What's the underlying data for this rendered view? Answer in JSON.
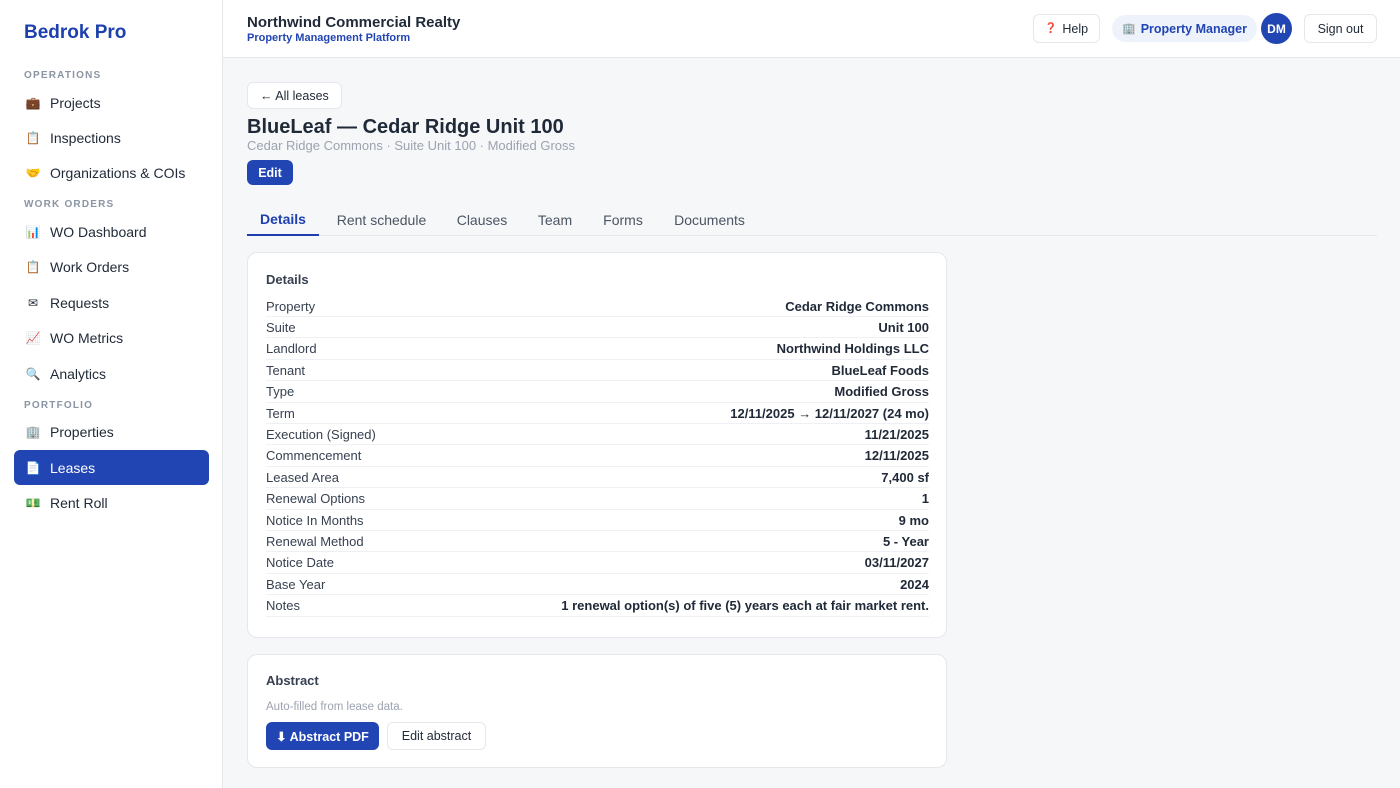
{
  "sidebar": {
    "brand": "Bedrok Pro",
    "sections": [
      {
        "title": "OPERATIONS"
      },
      {
        "title": "WORK ORDERS"
      },
      {
        "title": "PORTFOLIO"
      }
    ],
    "items": [
      {
        "label": "Projects",
        "icon": "briefcase-icon",
        "glyph": "💼"
      },
      {
        "label": "Inspections",
        "icon": "clipboard-icon",
        "glyph": "📋"
      },
      {
        "label": "Organizations & COIs",
        "icon": "handshake-icon",
        "glyph": "🤝"
      },
      {
        "label": "WO Dashboard",
        "icon": "bar-chart-icon",
        "glyph": "📊"
      },
      {
        "label": "Work Orders",
        "icon": "clipboard-icon",
        "glyph": "📋"
      },
      {
        "label": "Requests",
        "icon": "envelope-icon",
        "glyph": "✉"
      },
      {
        "label": "WO Metrics",
        "icon": "line-chart-icon",
        "glyph": "📈"
      },
      {
        "label": "Analytics",
        "icon": "magnifier-icon",
        "glyph": "🔍"
      },
      {
        "label": "Properties",
        "icon": "building-icon",
        "glyph": "🏢"
      },
      {
        "label": "Leases",
        "icon": "document-icon",
        "glyph": "📄",
        "active": true
      },
      {
        "label": "Rent Roll",
        "icon": "money-icon",
        "glyph": "💵"
      }
    ]
  },
  "header": {
    "org_name": "Northwind Commercial Realty",
    "org_subtitle": "Property Management Platform",
    "help_label": "Help",
    "help_glyph": "❓",
    "role_label": "Property Manager",
    "role_glyph": "🏢",
    "avatar_initials": "DM",
    "signout_label": "Sign out"
  },
  "page": {
    "back_label": "← All leases",
    "title": "BlueLeaf — Cedar Ridge Unit 100",
    "subtitle": "Cedar Ridge Commons · Suite Unit 100 · Modified Gross",
    "edit_label": "Edit"
  },
  "tabs": [
    {
      "label": "Details",
      "active": true
    },
    {
      "label": "Rent schedule"
    },
    {
      "label": "Clauses"
    },
    {
      "label": "Team"
    },
    {
      "label": "Forms"
    },
    {
      "label": "Documents"
    }
  ],
  "details": {
    "title": "Details",
    "rows": [
      {
        "label": "Property",
        "value": "Cedar Ridge Commons"
      },
      {
        "label": "Suite",
        "value": "Unit 100"
      },
      {
        "label": "Landlord",
        "value": "Northwind Holdings LLC"
      },
      {
        "label": "Tenant",
        "value": "BlueLeaf Foods"
      },
      {
        "label": "Type",
        "value": "Modified Gross"
      },
      {
        "label": "Term",
        "value": "12/11/2025 → 12/11/2027 (24 mo)"
      },
      {
        "label": "Execution (Signed)",
        "value": "11/21/2025"
      },
      {
        "label": "Commencement",
        "value": "12/11/2025"
      },
      {
        "label": "Leased Area",
        "value": "7,400 sf"
      },
      {
        "label": "Renewal Options",
        "value": "1"
      },
      {
        "label": "Notice In Months",
        "value": "9 mo"
      },
      {
        "label": "Renewal Method",
        "value": "5 - Year"
      },
      {
        "label": "Notice Date",
        "value": "03/11/2027"
      },
      {
        "label": "Base Year",
        "value": "2024"
      },
      {
        "label": "Notes",
        "value": "1 renewal option(s) of five (5) years each at fair market rent."
      }
    ]
  },
  "abstract": {
    "title": "Abstract",
    "note": "Auto-filled from lease data.",
    "pdf_label": "⬇ Abstract PDF",
    "edit_label": "Edit abstract"
  },
  "colors": {
    "accent": "#2145b3",
    "brand": "#1e40af",
    "muted": "#9ca3af"
  }
}
